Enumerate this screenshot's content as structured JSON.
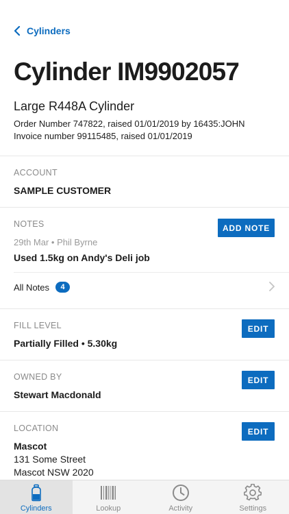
{
  "nav": {
    "back_label": "Cylinders"
  },
  "header": {
    "title": "Cylinder IM9902057",
    "subtitle": "Large R448A Cylinder",
    "order_line": "Order Number 747822, raised 01/01/2019 by 16435:JOHN",
    "invoice_line": "Invoice number 99115485, raised 01/01/2019"
  },
  "account": {
    "label": "ACCOUNT",
    "value": "SAMPLE CUSTOMER"
  },
  "notes": {
    "label": "NOTES",
    "add_label": "ADD NOTE",
    "latest_meta": "29th Mar • Phil Byrne",
    "latest_text": "Used 1.5kg on Andy's Deli job",
    "all_label": "All Notes",
    "count": "4"
  },
  "fill_level": {
    "label": "FILL LEVEL",
    "value": "Partially Filled • 5.30kg",
    "edit_label": "EDIT"
  },
  "owned_by": {
    "label": "OWNED BY",
    "value": "Stewart Macdonald",
    "edit_label": "EDIT"
  },
  "location": {
    "label": "LOCATION",
    "name": "Mascot",
    "street": "131 Some Street",
    "suburb": "Mascot NSW 2020",
    "edit_label": "EDIT"
  },
  "tabs": [
    {
      "label": "Cylinders",
      "icon": "cylinder-icon",
      "active": true
    },
    {
      "label": "Lookup",
      "icon": "barcode-icon",
      "active": false
    },
    {
      "label": "Activity",
      "icon": "clock-icon",
      "active": false
    },
    {
      "label": "Settings",
      "icon": "gear-icon",
      "active": false
    }
  ],
  "colors": {
    "accent": "#0d6cbf",
    "label_grey": "#8a8a8a",
    "tabbar_bg": "#f4f4f4"
  }
}
